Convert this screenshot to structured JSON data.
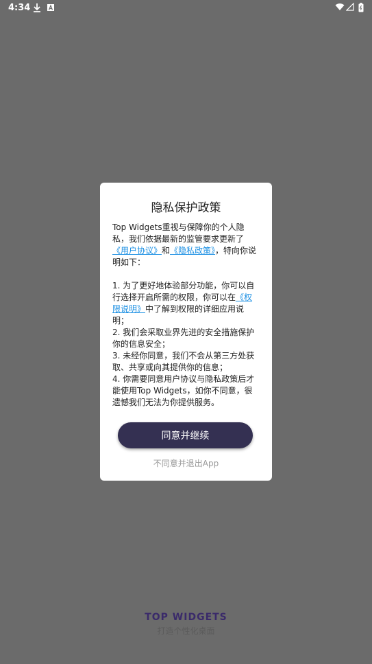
{
  "status_bar": {
    "time": "4:34",
    "icons": [
      "download-icon",
      "a-icon",
      "wifi-icon",
      "signal-icon",
      "battery-icon"
    ]
  },
  "dialog": {
    "title": "隐私保护政策",
    "intro_part1": "Top Widgets重视与保障你的个人隐私，我们依据最新的监管要求更新了",
    "link_user_agreement": "《用户协议》",
    "intro_and": "和",
    "link_privacy_policy": "《隐私政策》",
    "intro_part2": "，特向你说明如下：",
    "item1_part1": "1. 为了更好地体验部分功能，你可以自行选择开启所需的权限，你可以在",
    "link_permissions": "《权限说明》",
    "item1_part2": "中了解到权限的详细应用说明；",
    "item2": "2. 我们会采取业界先进的安全措施保护你的信息安全；",
    "item3": "3. 未经你同意，我们不会从第三方处获取、共享或向其提供你的信息；",
    "item4": "4. 你需要同意用户协议与隐私政策后才能使用Top Widgets，如你不同意，很遗憾我们无法为你提供服务。",
    "agree_button": "同意并继续",
    "disagree_link": "不同意并退出App"
  },
  "brand": {
    "logo_text": "TOP WIDGETS",
    "tagline": "打造个性化桌面"
  },
  "colors": {
    "overlay_background": "#6b6b6b",
    "button_background": "#343052",
    "link": "#1a8fe3"
  }
}
